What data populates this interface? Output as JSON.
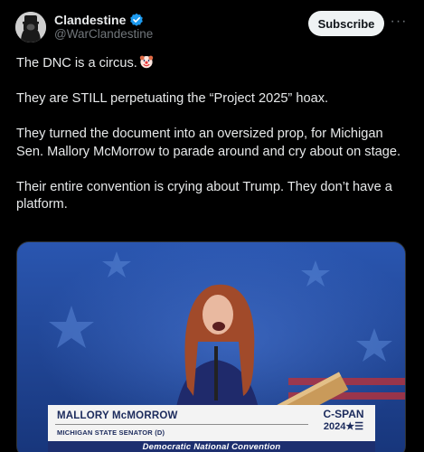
{
  "author": {
    "display_name": "Clandestine",
    "handle": "@WarClandestine",
    "avatar_icon": "hooded-figure-avatar",
    "verified_icon": "verified-badge-icon"
  },
  "actions": {
    "subscribe_label": "Subscribe",
    "more_label": "···"
  },
  "post": {
    "paragraphs": [
      "The DNC is a circus.",
      "They are STILL perpetuating the “Project 2025” hoax.",
      "They turned the document into an oversized prop, for Michigan Sen. Mallory McMorrow to parade around and cry about on stage.",
      "Their entire convention is crying about Trump. They don’t have a platform."
    ],
    "emoji_icon": "clown-face-emoji"
  },
  "media": {
    "lower_third_name": "MALLORY McMORROW",
    "lower_third_title": "MICHIGAN STATE SENATOR (D)",
    "logo_line1": "C-SPAN",
    "logo_line2": "2024★☰",
    "band_text": "Democratic National Convention"
  },
  "colors": {
    "background": "#000000",
    "text": "#e7e9ea",
    "secondary_text": "#71767b",
    "verified_blue": "#1d9bf0",
    "subscribe_bg": "#eff3f4",
    "stage_blue": "#1b3f8c",
    "lower_third_navy": "#1d2f6f"
  }
}
